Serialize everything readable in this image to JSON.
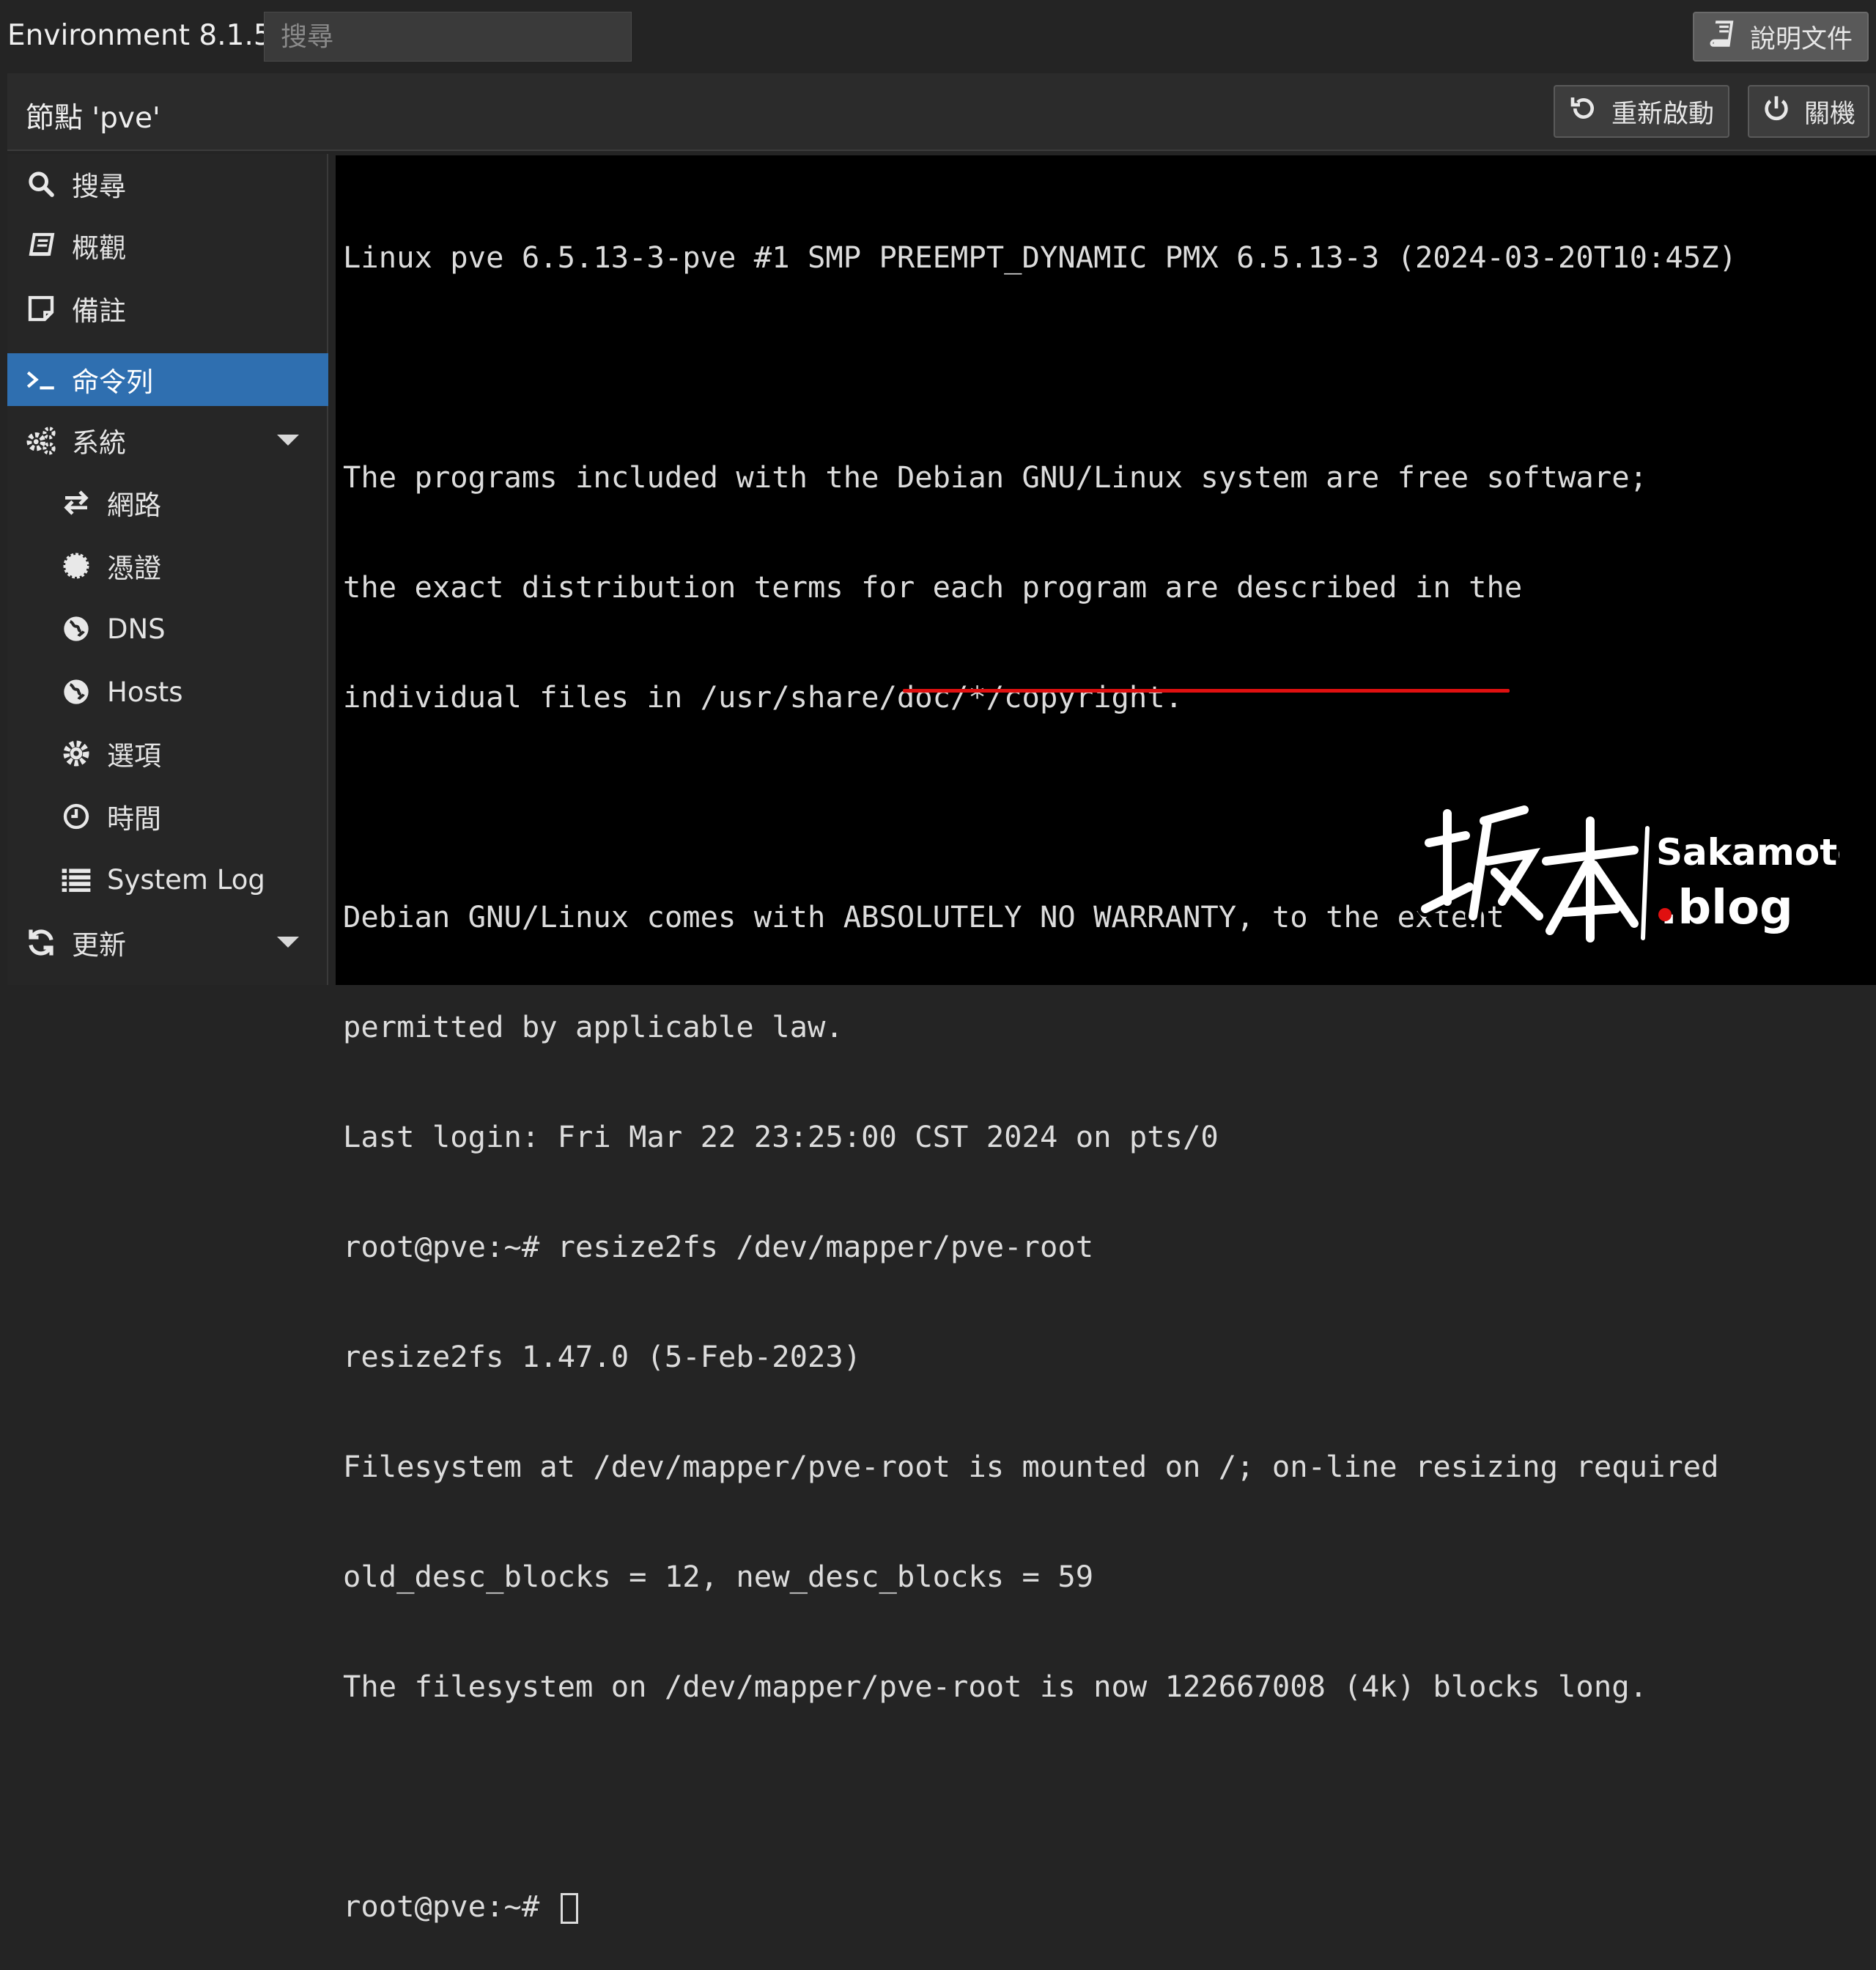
{
  "header": {
    "app_title": "Environment 8.1.5",
    "search_placeholder": "搜尋",
    "docs_label": "說明文件"
  },
  "node": {
    "title": "節點 'pve'",
    "reboot_label": "重新啟動",
    "shutdown_label": "關機"
  },
  "sidebar": {
    "items": [
      {
        "label": "搜尋",
        "icon": "search-icon"
      },
      {
        "label": "概觀",
        "icon": "book-icon"
      },
      {
        "label": "備註",
        "icon": "note-icon"
      },
      {
        "label": "命令列",
        "icon": "terminal-icon",
        "active": true
      },
      {
        "label": "系統",
        "icon": "gears-icon",
        "expandable": true
      },
      {
        "label": "網路",
        "icon": "exchange-icon"
      },
      {
        "label": "憑證",
        "icon": "certificate-icon"
      },
      {
        "label": "DNS",
        "icon": "globe-icon"
      },
      {
        "label": "Hosts",
        "icon": "globe-icon"
      },
      {
        "label": "選項",
        "icon": "gear-icon"
      },
      {
        "label": "時間",
        "icon": "clock-icon"
      },
      {
        "label": "System Log",
        "icon": "list-icon"
      },
      {
        "label": "更新",
        "icon": "refresh-icon",
        "expandable": true
      }
    ]
  },
  "terminal": {
    "lines": [
      "Linux pve 6.5.13-3-pve #1 SMP PREEMPT_DYNAMIC PMX 6.5.13-3 (2024-03-20T10:45Z)",
      "",
      "The programs included with the Debian GNU/Linux system are free software;",
      "the exact distribution terms for each program are described in the",
      "individual files in /usr/share/doc/*/copyright.",
      "",
      "Debian GNU/Linux comes with ABSOLUTELY NO WARRANTY, to the extent",
      "permitted by applicable law.",
      "Last login: Fri Mar 22 23:25:00 CST 2024 on pts/0",
      "root@pve:~# resize2fs /dev/mapper/pve-root",
      "resize2fs 1.47.0 (5-Feb-2023)",
      "Filesystem at /dev/mapper/pve-root is mounted on /; on-line resizing required",
      "old_desc_blocks = 12, new_desc_blocks = 59",
      "The filesystem on /dev/mapper/pve-root is now 122667008 (4k) blocks long.",
      "",
      "root@pve:~# "
    ],
    "highlight_color": "#e01010"
  },
  "watermark": {
    "logo_text": "坂本 Sakamoto .blog"
  },
  "colors": {
    "accent": "#2f6fb0",
    "background": "#242424",
    "terminal_bg": "#000000"
  }
}
